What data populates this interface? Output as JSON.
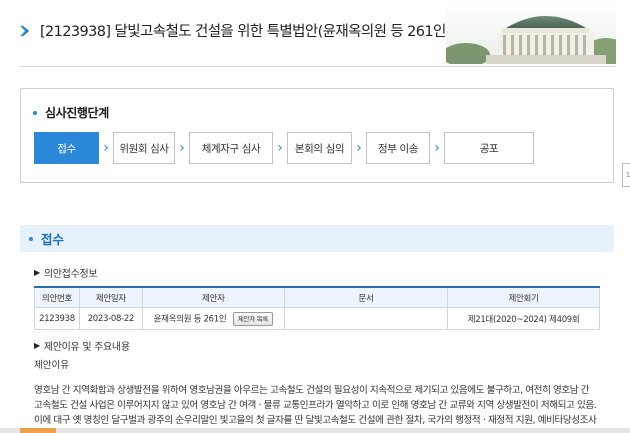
{
  "header": {
    "bill_title": "[2123938] 달빛고속철도 건설을 위한 특별법안(윤재옥의원 등 261인)"
  },
  "stage": {
    "title": "심사진행단계",
    "steps": [
      "접수",
      "위원회 심사",
      "체계자구 심사",
      "본회의 심의",
      "정부 이송",
      "공포"
    ]
  },
  "side_tab": {
    "label": "1"
  },
  "section": {
    "title": "접수",
    "info_heading": "의안접수정보",
    "table": {
      "headers": [
        "의안번호",
        "제안일자",
        "제안자",
        "문서",
        "제안회기"
      ],
      "row": {
        "bill_no": "2123938",
        "date": "2023-08-22",
        "proposer": "윤재옥의원 등 261인",
        "proposer_button": "제안자 목록",
        "document": "",
        "session": "제21대(2020~2024) 제409회"
      }
    },
    "reason_heading": "제안이유 및 주요내용",
    "reason_label": "제안이유",
    "body_lines": [
      "영호남 간 지역화합과 상생발전을 위하여 영호남권을 아우르는 고속철도 건설의 필요성이 지속적으로 제기되고 있음에도 불구하고, 여전히 영호남 간",
      "고속철도 건설 사업은 이루어지지 않고 있어 영호남 간 여객 · 물류 교통인프라가 열악하고 이로 인해 영호남 간 교류와 지역 상생발전이 저해되고 있음.",
      "이에 대구 옛 명칭인 달구벌과 광주의 순우리말인 빛고을의 첫 글자를 딴 달빛고속철도 건설에 관한 절차, 국가의 행정적 · 재정적 지원, 예비타당성조사"
    ]
  },
  "colors": {
    "accent": "#2b88d8",
    "section_bg": "#e6f1fb",
    "table_head_bg": "#eef4fb"
  }
}
